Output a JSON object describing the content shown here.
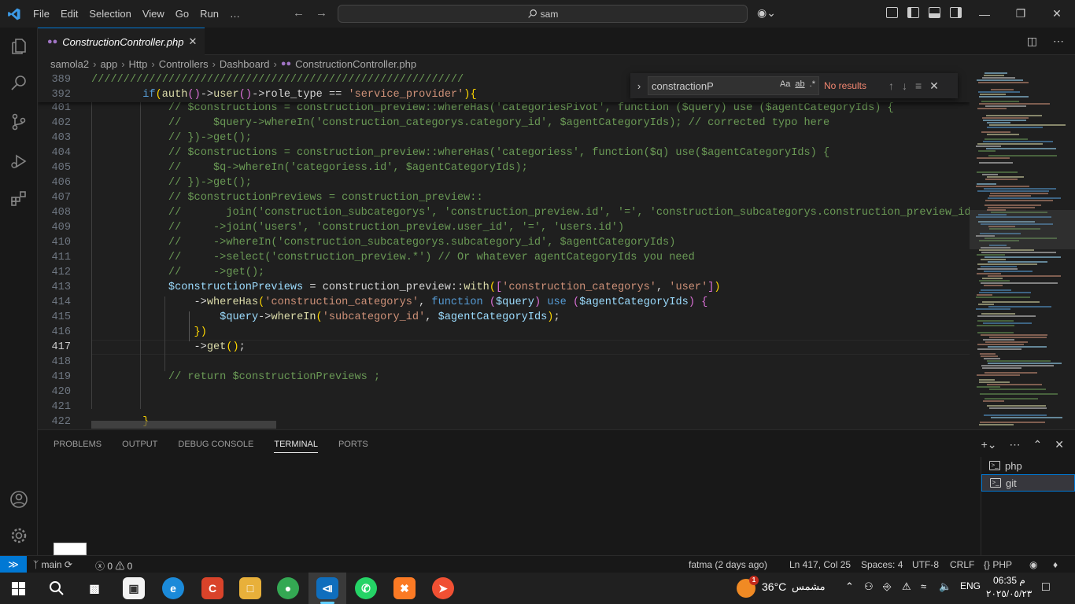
{
  "titlebar": {
    "menu": [
      "File",
      "Edit",
      "Selection",
      "View",
      "Go",
      "Run",
      "…"
    ],
    "search_text": "sam"
  },
  "tab": {
    "filename": "ConstructionController.php",
    "close_glyph": "✕"
  },
  "breadcrumb": [
    "samola2",
    "app",
    "Http",
    "Controllers",
    "Dashboard",
    "ConstructionController.php"
  ],
  "find_widget": {
    "query": "constractionP",
    "match_case": "Aa",
    "whole_word": "ab",
    "regex": ".*",
    "result": "No results"
  },
  "code": {
    "sticky": [
      {
        "n": "389",
        "text": "//////////////////////////////////////////////////////////"
      },
      {
        "n": "392",
        "text": "        if(auth()->user()->role_type == 'service_provider'){"
      }
    ],
    "lines": [
      {
        "n": "401",
        "text": "            // $constructions = construction_preview::whereHas('categoriesPivot', function ($query) use ($agentCategoryIds) {"
      },
      {
        "n": "402",
        "text": "            //     $query->whereIn('construction_categorys.category_id', $agentCategoryIds); // corrected typo here"
      },
      {
        "n": "403",
        "text": "            // })->get();"
      },
      {
        "n": "404",
        "text": "            // $constructions = construction_preview::whereHas('categoriess', function($q) use($agentCategoryIds) {"
      },
      {
        "n": "405",
        "text": "            //     $q->whereIn('categoriess.id', $agentCategoryIds);"
      },
      {
        "n": "406",
        "text": "            // })->get();"
      },
      {
        "n": "407",
        "text": "            // $constructionPreviews = construction_preview::"
      },
      {
        "n": "408",
        "text": "            //       join('construction_subcategorys', 'construction_preview.id', '=', 'construction_subcategorys.construction_preview_id')"
      },
      {
        "n": "409",
        "text": "            //     ->join('users', 'construction_preview.user_id', '=', 'users.id')"
      },
      {
        "n": "410",
        "text": "            //     ->whereIn('construction_subcategorys.subcategory_id', $agentCategoryIds)"
      },
      {
        "n": "411",
        "text": "            //     ->select('construction_preview.*') // Or whatever agentCategoryIds you need"
      },
      {
        "n": "412",
        "text": "            //     ->get();"
      },
      {
        "n": "413",
        "text": "            $constructionPreviews = construction_preview::with(['construction_categorys', 'user'])"
      },
      {
        "n": "414",
        "text": "                ->whereHas('construction_categorys', function ($query) use ($agentCategoryIds) {"
      },
      {
        "n": "415",
        "text": "                    $query->whereIn('subcategory_id', $agentCategoryIds);"
      },
      {
        "n": "416",
        "text": "                })"
      },
      {
        "n": "417",
        "text": "                ->get();"
      },
      {
        "n": "418",
        "text": ""
      },
      {
        "n": "419",
        "text": "            // return $constructionPreviews ;"
      },
      {
        "n": "420",
        "text": ""
      },
      {
        "n": "421",
        "text": ""
      },
      {
        "n": "422",
        "text": "        }"
      }
    ]
  },
  "panel": {
    "tabs": [
      "PROBLEMS",
      "OUTPUT",
      "DEBUG CONSOLE",
      "TERMINAL",
      "PORTS"
    ],
    "active_tab": "TERMINAL",
    "terminals": [
      "php",
      "git"
    ],
    "selected_terminal": "git"
  },
  "statusbar": {
    "branch": "main",
    "problems": "ⓧ 0 ⚠ 0",
    "blame": "fatma (2 days ago)",
    "position": "Ln 417, Col 25",
    "spaces": "Spaces: 4",
    "encoding": "UTF-8",
    "eol": "CRLF",
    "language": "PHP"
  },
  "taskbar": {
    "weather_temp": "36°C",
    "weather_text": "مشمس",
    "weather_badge": "1",
    "lang": "ENG",
    "time": "06:35 م",
    "date": "٢٠٢٥/٠٥/٢٣"
  },
  "colors": {
    "accent": "#0078d4",
    "comment": "#6a9955",
    "keyword": "#569cd6",
    "variable": "#9cdcfe",
    "function": "#dcdcaa",
    "string": "#ce9178",
    "no_results": "#f48771"
  }
}
